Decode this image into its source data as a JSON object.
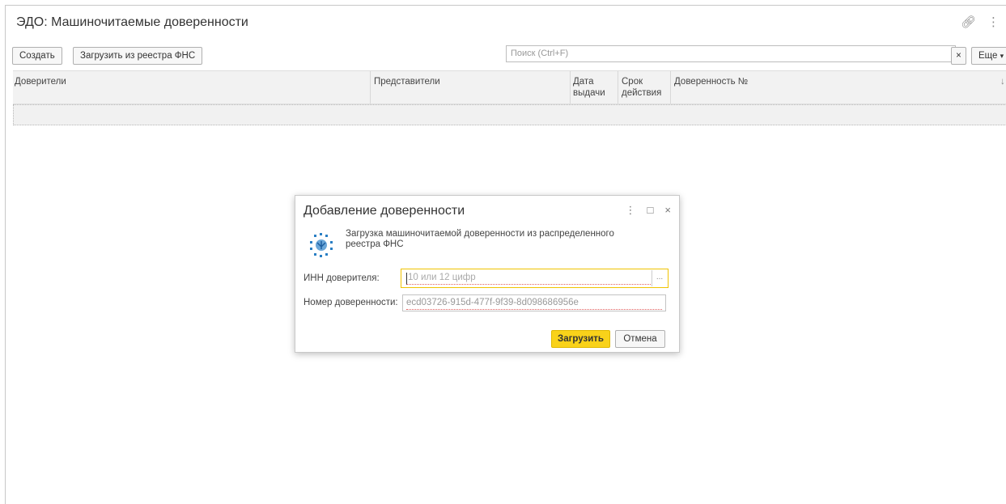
{
  "window": {
    "title": "ЭДО: Машиночитаемые доверенности",
    "link_icon": "link-icon",
    "menu_icon": "more-vertical-icon"
  },
  "toolbar": {
    "create_label": "Создать",
    "load_fns_label": "Загрузить из реестра ФНС",
    "search_placeholder": "Поиск (Ctrl+F)",
    "clear_search_label": "×",
    "more_label": "Еще",
    "more_icon": "chevron-down-icon"
  },
  "table": {
    "columns": [
      {
        "key": "principals",
        "label": "Доверители"
      },
      {
        "key": "representatives",
        "label": "Представители"
      },
      {
        "key": "issue_date",
        "label": "Дата выдачи"
      },
      {
        "key": "validity",
        "label": "Срок действия"
      },
      {
        "key": "poa_number",
        "label": "Доверенность №"
      }
    ],
    "issue_date_lines": [
      "Дата",
      "выдачи"
    ],
    "validity_lines": [
      "Срок",
      "действия"
    ],
    "sort_icon": "↓",
    "rows": []
  },
  "dialog": {
    "title": "Добавление доверенности",
    "description": "Загрузка машиночитаемой доверенности из распределенного реестра ФНС",
    "logo_icon": "fns-logo-icon",
    "inn_label": "ИНН доверителя:",
    "inn_placeholder": "10 или 12 цифр",
    "inn_value": "",
    "inn_select_label": "...",
    "number_label": "Номер доверенности:",
    "number_value": "ecd03726-915d-477f-9f39-8d098686956e",
    "load_button": "Загрузить",
    "cancel_button": "Отмена",
    "menu_glyph": "⋮",
    "maximize_glyph": "□",
    "close_glyph": "×"
  },
  "colors": {
    "accent_yellow": "#f9d21a",
    "focus_border": "#f0c300",
    "error_underline": "#e06060"
  }
}
